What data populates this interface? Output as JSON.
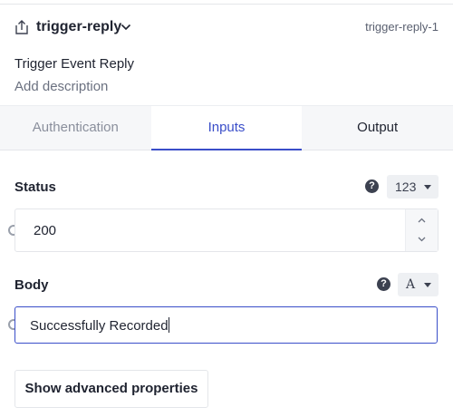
{
  "step": {
    "name": "trigger-reply",
    "id": "trigger-reply-1",
    "title": "Trigger Event Reply",
    "description": "Add description",
    "icon": "export-icon"
  },
  "tabs": [
    {
      "label": "Authentication",
      "state": "disabled"
    },
    {
      "label": "Inputs",
      "state": "active"
    },
    {
      "label": "Output",
      "state": "normal"
    }
  ],
  "fields": {
    "status": {
      "label": "Status",
      "help": "?",
      "type_label": "123",
      "value": "200"
    },
    "body": {
      "label": "Body",
      "help": "?",
      "type_label": "A",
      "value": "Successfully Recorded"
    }
  },
  "advanced_button": "Show advanced properties",
  "colors": {
    "accent": "#3a4ec9",
    "text": "#1f2330",
    "muted": "#8a8f9c",
    "border": "#e4e6ea"
  }
}
